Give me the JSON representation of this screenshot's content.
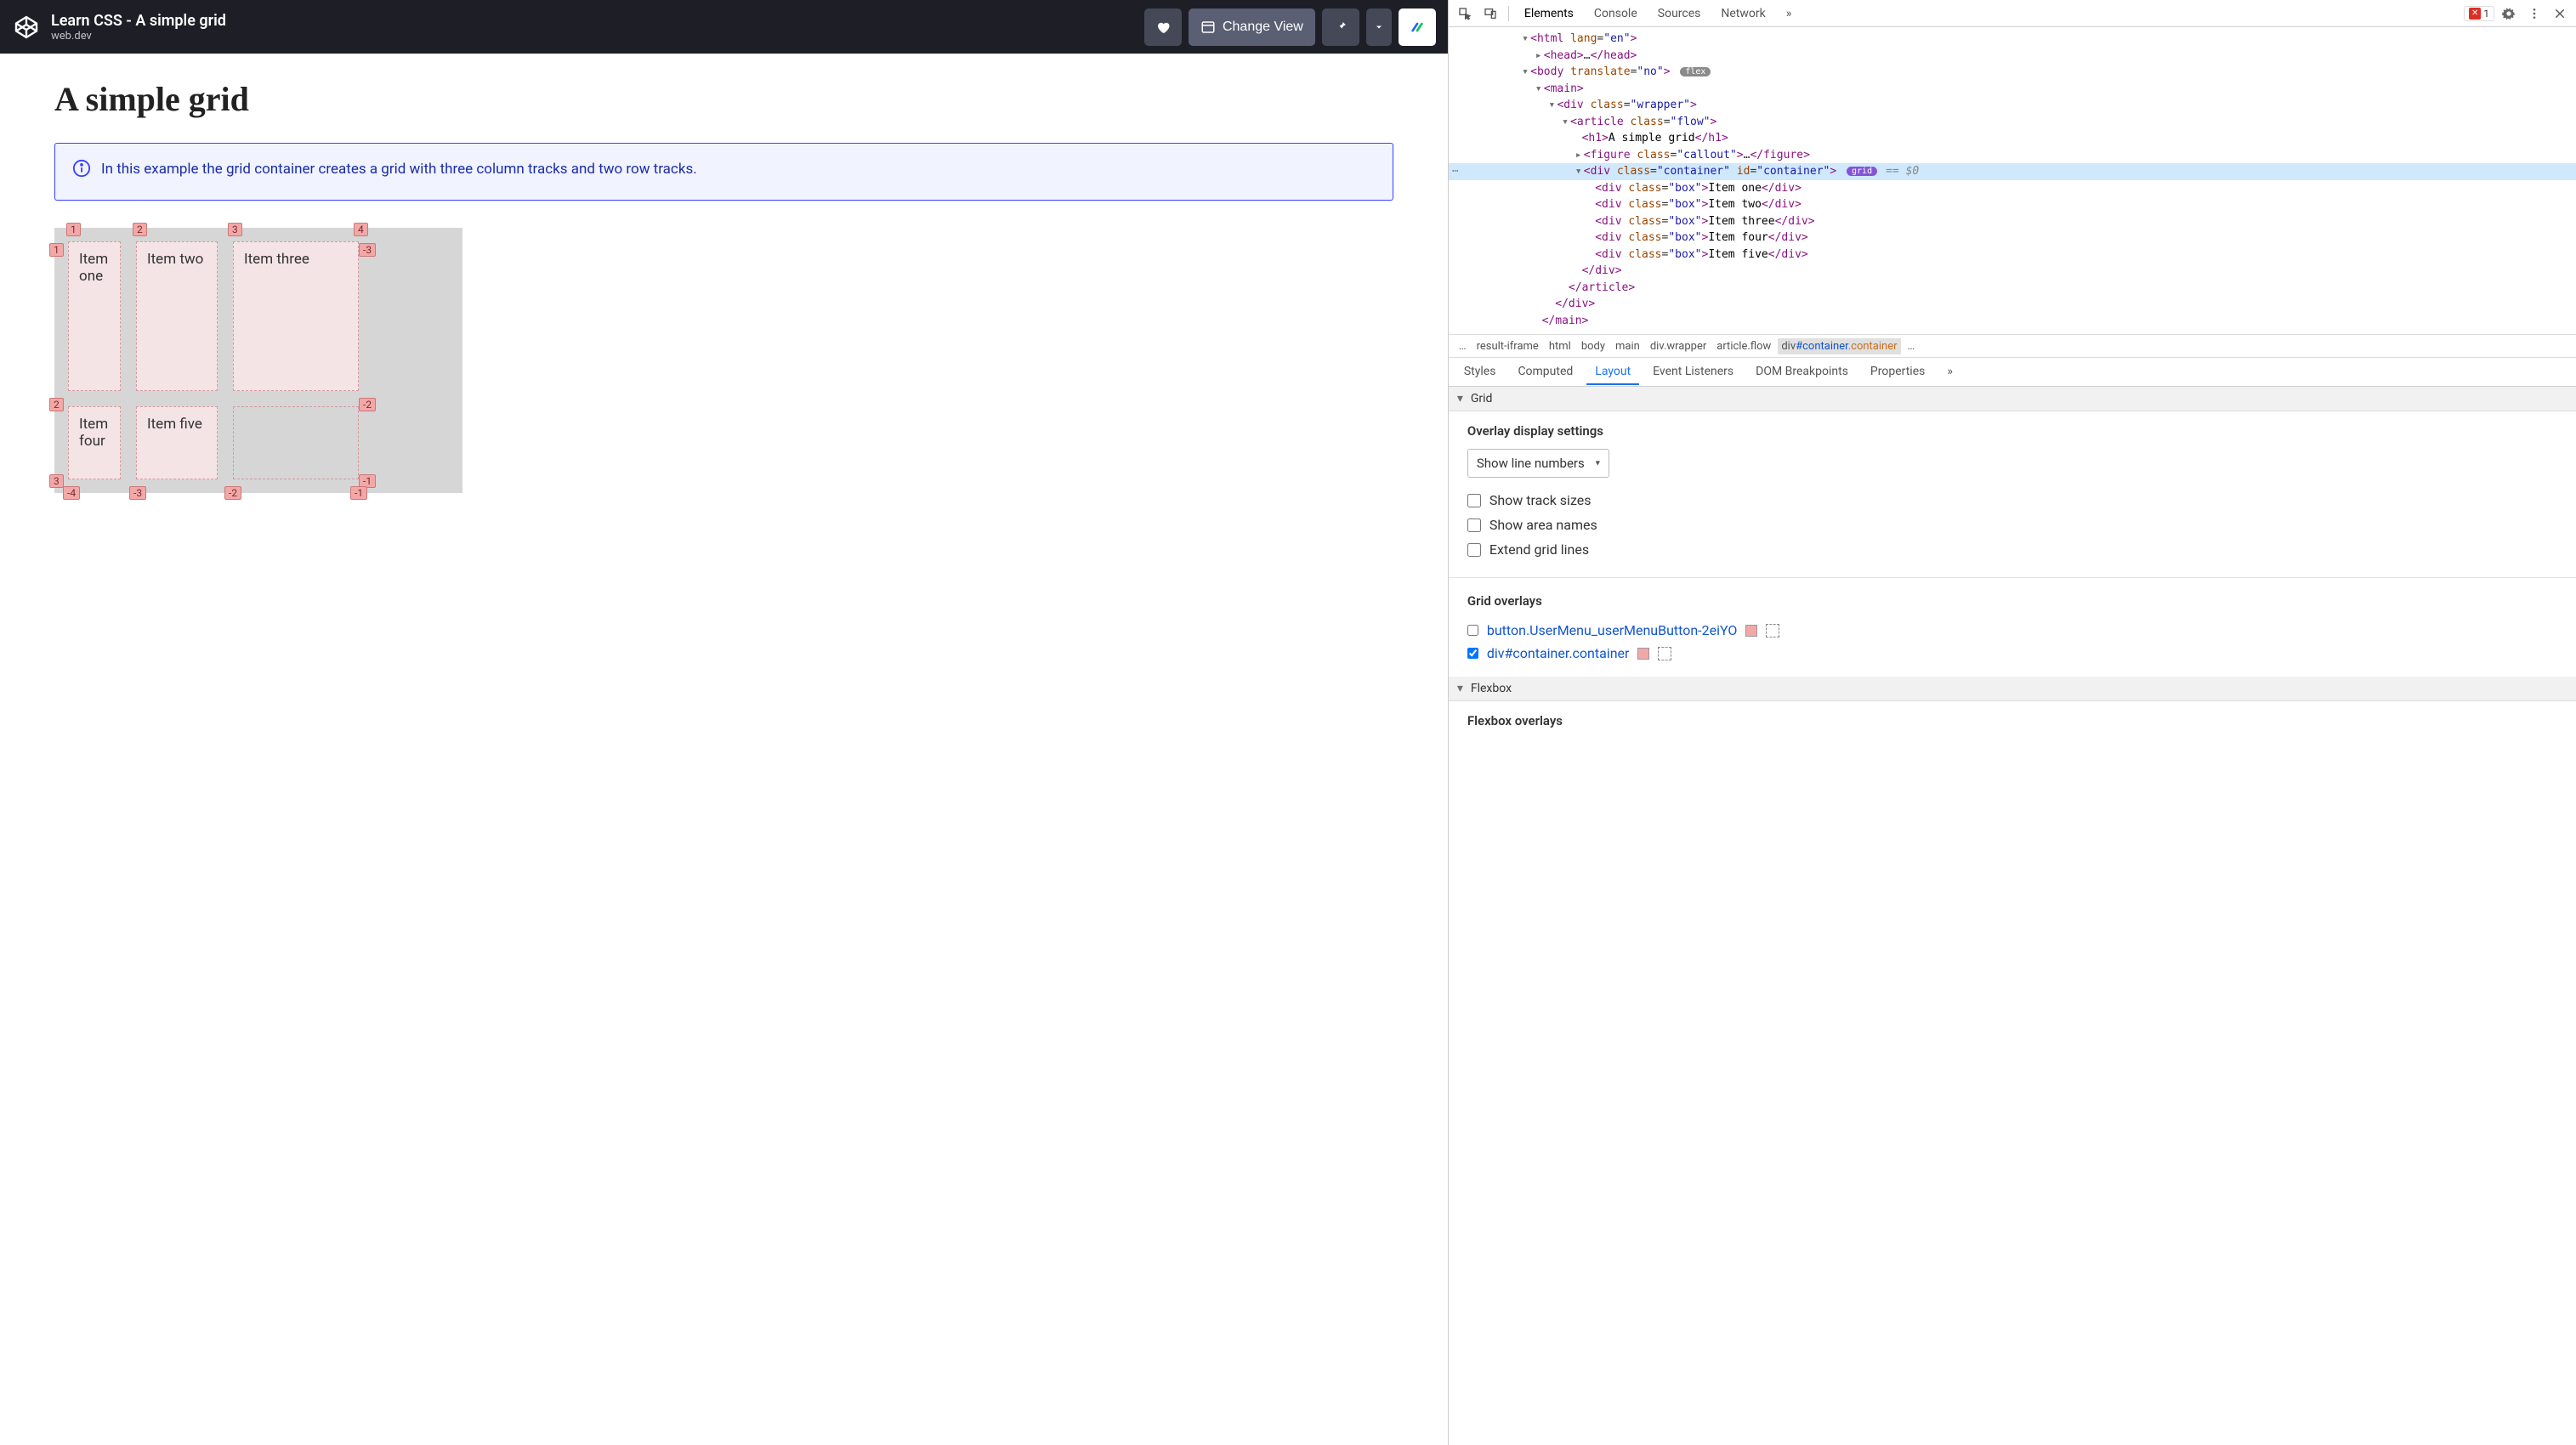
{
  "pen": {
    "title": "Learn CSS - A simple grid",
    "subtitle": "web.dev",
    "change_view": "Change View"
  },
  "page": {
    "heading": "A simple grid",
    "callout": "In this example the grid container creates a grid with three column tracks and two row tracks.",
    "items": [
      "Item one",
      "Item two",
      "Item three",
      "Item four",
      "Item five"
    ],
    "line_labels": {
      "cols_top": [
        "1",
        "2",
        "3",
        "4"
      ],
      "cols_bottom": [
        "-4",
        "-3",
        "-2",
        "-1"
      ],
      "rows_left": [
        "1",
        "2",
        "3"
      ],
      "rows_right": [
        "-3",
        "-2",
        "-1"
      ]
    }
  },
  "devtools": {
    "tabs": [
      "Elements",
      "Console",
      "Sources",
      "Network"
    ],
    "more": "»",
    "error_count": "1",
    "dom": {
      "l0": "<html lang=\"en\">",
      "l1a": "<head>",
      "l1b": "</head>",
      "l2a": "<body translate=\"no\">",
      "l2pill": "flex",
      "l3a": "<main>",
      "l4a": "<div class=\"wrapper\">",
      "l5a": "<article class=\"flow\">",
      "l6a": "<h1>",
      "l6t": "A simple grid",
      "l6b": "</h1>",
      "l7a": "<figure class=\"callout\">",
      "l7b": "</figure>",
      "l8a": "<div class=\"container\" id=\"container\">",
      "l8pill": "grid",
      "l8eq": "== $0",
      "box_lines": [
        {
          "open": "<div class=\"box\">",
          "text": "Item one",
          "close": "</div>"
        },
        {
          "open": "<div class=\"box\">",
          "text": "Item two",
          "close": "</div>"
        },
        {
          "open": "<div class=\"box\">",
          "text": "Item three",
          "close": "</div>"
        },
        {
          "open": "<div class=\"box\">",
          "text": "Item four",
          "close": "</div>"
        },
        {
          "open": "<div class=\"box\">",
          "text": "Item five",
          "close": "</div>"
        }
      ],
      "l9": "</div>",
      "l10": "</article>",
      "l11": "</div>",
      "l12": "</main>"
    },
    "crumbs": {
      "ell": "…",
      "c0": "result-iframe",
      "c1": "html",
      "c2": "body",
      "c3": "main",
      "c4": "div.wrapper",
      "c5": "article.flow",
      "c6_pre": "div",
      "c6_id": "#container",
      "c6_cls": ".container"
    },
    "subtabs": [
      "Styles",
      "Computed",
      "Layout",
      "Event Listeners",
      "DOM Breakpoints",
      "Properties"
    ],
    "subtabs_more": "»",
    "grid_section": "Grid",
    "overlay_settings_title": "Overlay display settings",
    "select_value": "Show line numbers",
    "checks": [
      "Show track sizes",
      "Show area names",
      "Extend grid lines"
    ],
    "grid_overlays_title": "Grid overlays",
    "overlays": [
      {
        "label": "button.UserMenu_userMenuButton-2eiYO",
        "checked": false
      },
      {
        "label": "div#container.container",
        "checked": true
      }
    ],
    "flexbox_section": "Flexbox",
    "flexbox_overlays_title": "Flexbox overlays"
  }
}
